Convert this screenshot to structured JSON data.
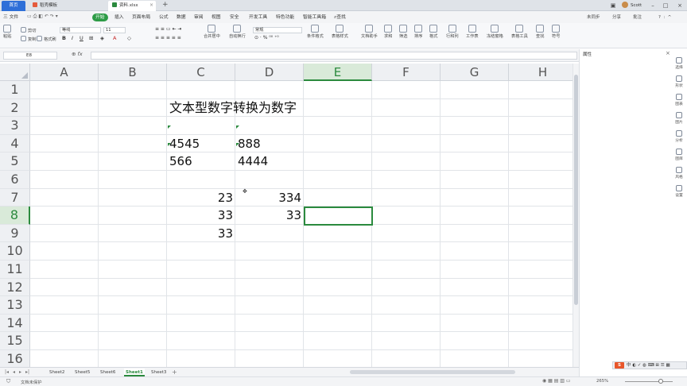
{
  "tabs": {
    "home": "首页",
    "template_tab": "稻壳模板",
    "file_tab": "资料.xlsx",
    "add": "+"
  },
  "user": {
    "name": "Scott"
  },
  "menu": {
    "file": "三 文件",
    "items": [
      "开始",
      "插入",
      "页面布局",
      "公式",
      "数据",
      "审阅",
      "视图",
      "安全",
      "开发工具",
      "特色功能",
      "智能工具箱"
    ],
    "search": "查找",
    "right": [
      "未同步",
      "分享",
      "批注"
    ]
  },
  "ribbon": {
    "paste": "粘贴",
    "cut": "剪切",
    "copy": "复制",
    "format_painter": "格式刷",
    "font_name": "等线",
    "font_size": "11",
    "number_format": "常规",
    "merge": "合并居中",
    "wrap": "自动换行",
    "groups": [
      "条件格式",
      "表格样式",
      "文档助手",
      "求和",
      "筛选",
      "排序",
      "格式",
      "行和列",
      "工作表",
      "冻结窗格",
      "表格工具",
      "查找",
      "符号"
    ]
  },
  "formula_bar": {
    "name_box": "E8",
    "formula": ""
  },
  "grid": {
    "columns": [
      "A",
      "B",
      "C",
      "D",
      "E",
      "F",
      "G",
      "H"
    ],
    "rows": [
      "1",
      "2",
      "3",
      "4",
      "5",
      "6",
      "7",
      "8",
      "9",
      "10",
      "11",
      "12",
      "13",
      "14",
      "15",
      "16"
    ],
    "selected_column": "E",
    "selected_row": "8",
    "cells": {
      "C2": "文本型数字转换为数字",
      "C4": "4545",
      "D4": "888",
      "C5": "566",
      "D5": "4444",
      "C7": "23",
      "D7": "334",
      "C8": "33",
      "D8": "33",
      "C9": "33"
    }
  },
  "sheets": [
    "Sheet2",
    "Sheet5",
    "Sheet6",
    "Sheet1",
    "Sheet3"
  ],
  "active_sheet": "Sheet1",
  "status": {
    "text": "文档未保护",
    "zoom": "265%"
  },
  "right_panel": {
    "title": "属性",
    "items": [
      "选择",
      "形状",
      "图表",
      "图片",
      "分析",
      "图库",
      "风格",
      "设置"
    ]
  },
  "ime": {
    "logo": "S",
    "label": "中"
  },
  "colors": {
    "accent": "#2b8a3e",
    "tab_active": "#2e6fd8"
  }
}
